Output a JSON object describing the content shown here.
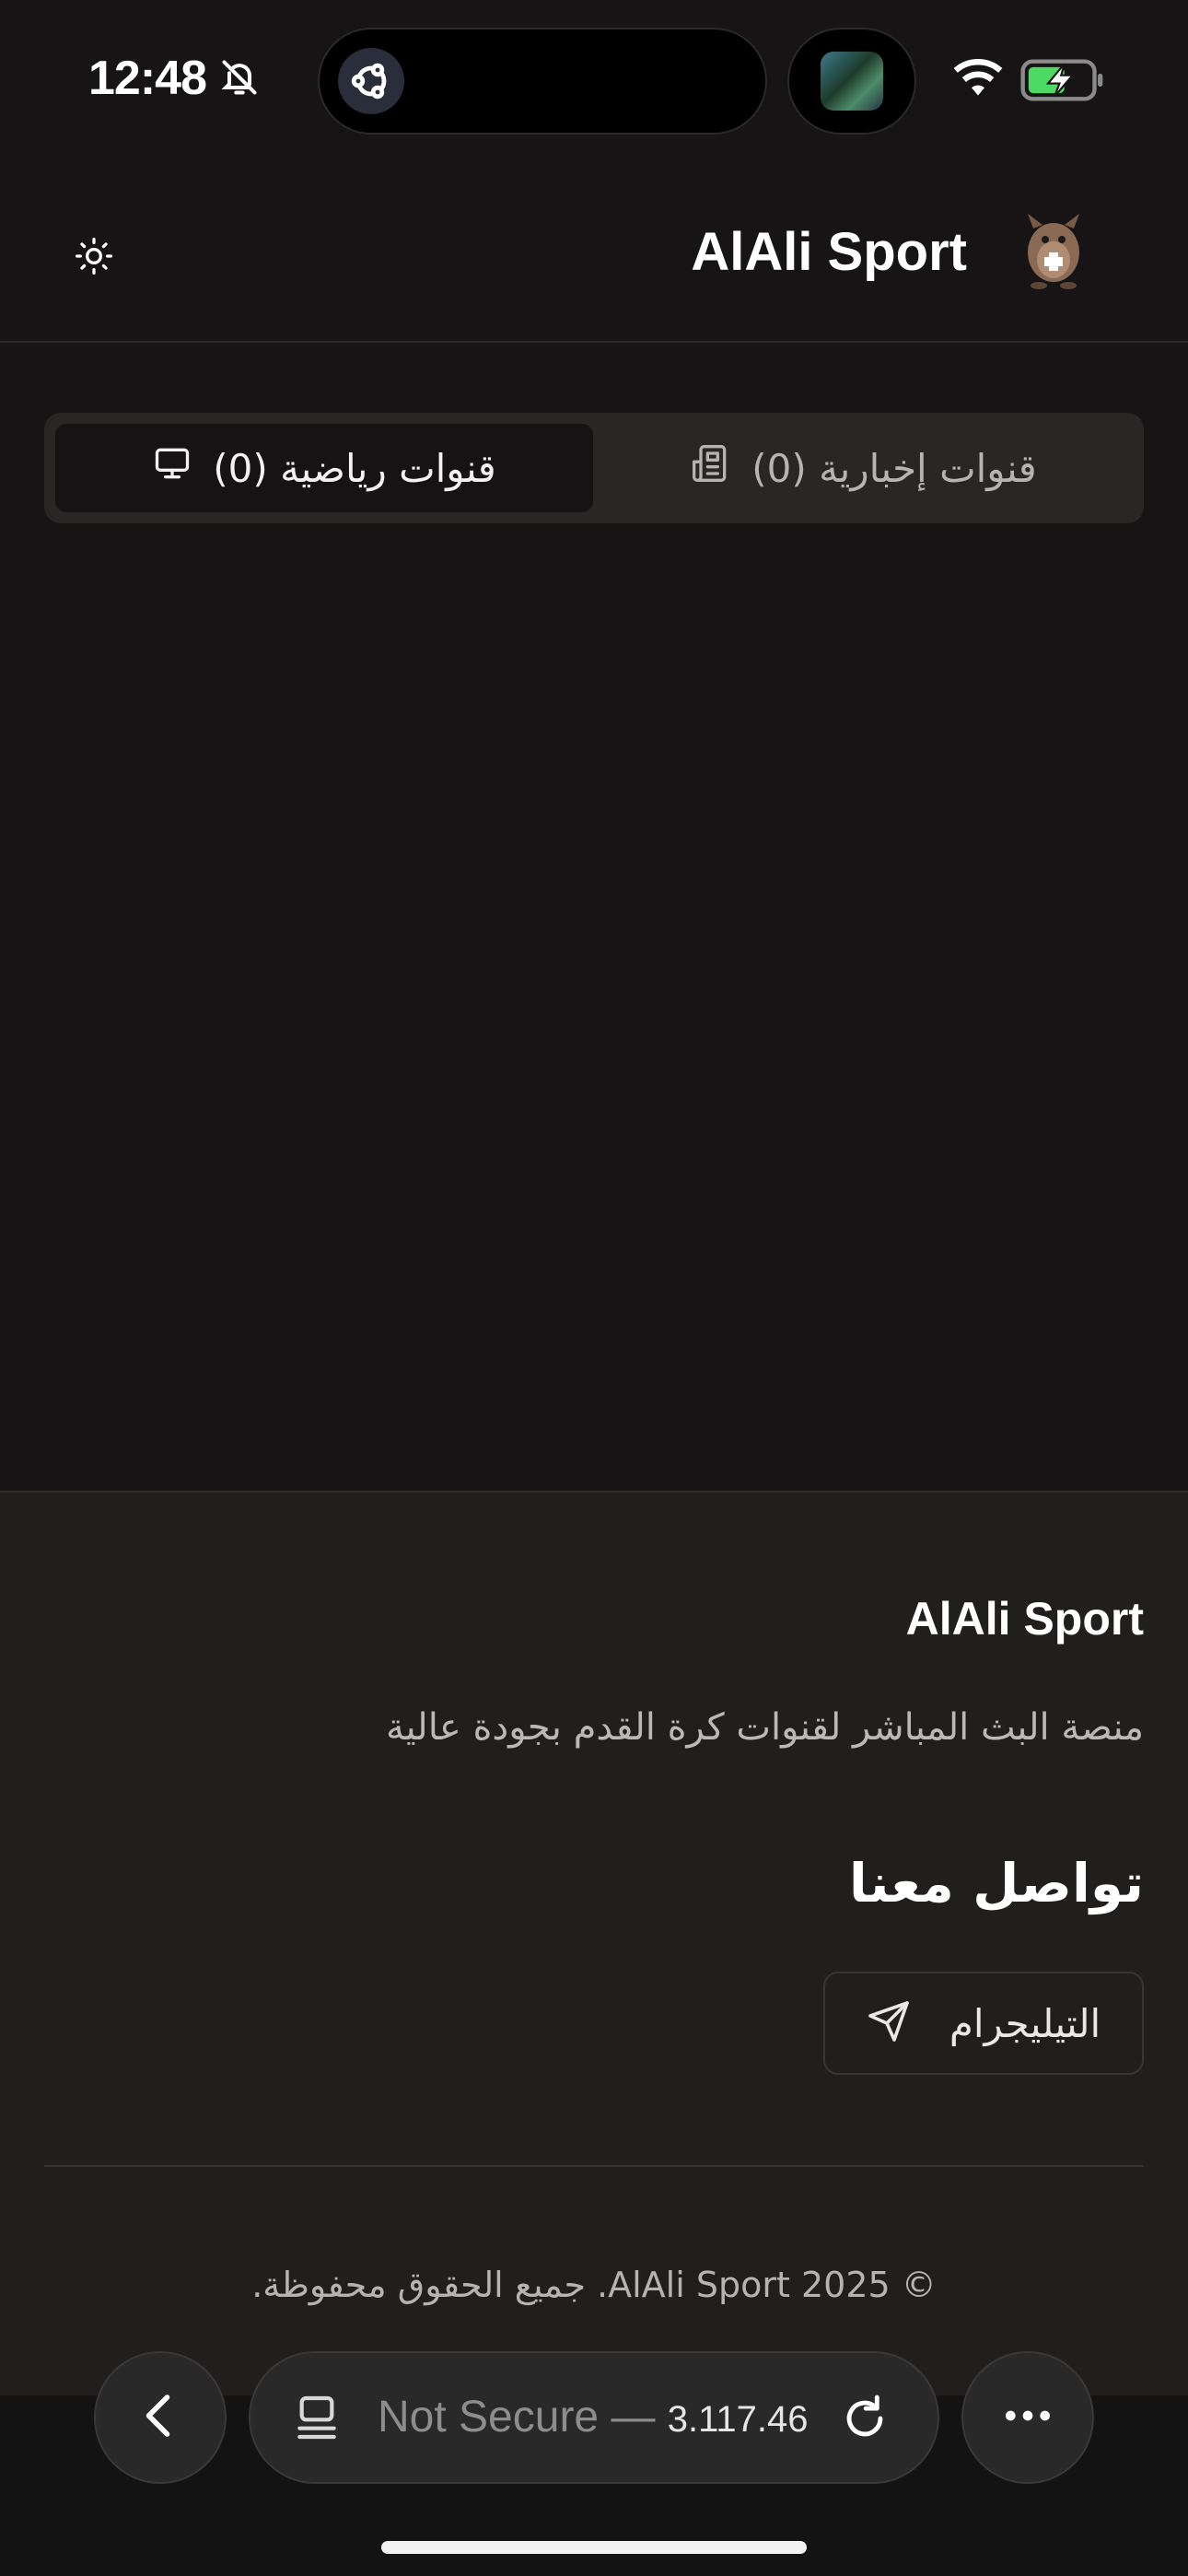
{
  "status_bar": {
    "time": "12:48",
    "icons": [
      "bell-slash-icon",
      "ubuntu-icon",
      "wifi-icon",
      "battery-charging-icon"
    ]
  },
  "header": {
    "title": "AlAli Sport",
    "logo_icon": "mascot-logo",
    "theme_icon": "sun-icon"
  },
  "tabs": [
    {
      "label": "قنوات رياضية (0)",
      "icon": "tv-icon",
      "active": true
    },
    {
      "label": "قنوات إخبارية (0)",
      "icon": "newspaper-icon",
      "active": false
    }
  ],
  "footer": {
    "brand": "AlAli Sport",
    "description": "منصة البث المباشر لقنوات كرة القدم بجودة عالية",
    "contact_heading": "تواصل معنا",
    "telegram_label": "التيليجرام",
    "telegram_icon": "send-icon",
    "copyright": "© 2025 AlAli Sport. جميع الحقوق محفوظة."
  },
  "browser": {
    "security_label": "Not Secure — ",
    "host_fragment": "3.117.46",
    "icons": [
      "back-icon",
      "tabs-icon",
      "reload-icon",
      "more-icon"
    ]
  },
  "colors": {
    "background": "#161414",
    "footer": "#211e1e",
    "tab_container": "#2a2626",
    "tab_active": "#151313",
    "battery_green": "#4cd964"
  }
}
